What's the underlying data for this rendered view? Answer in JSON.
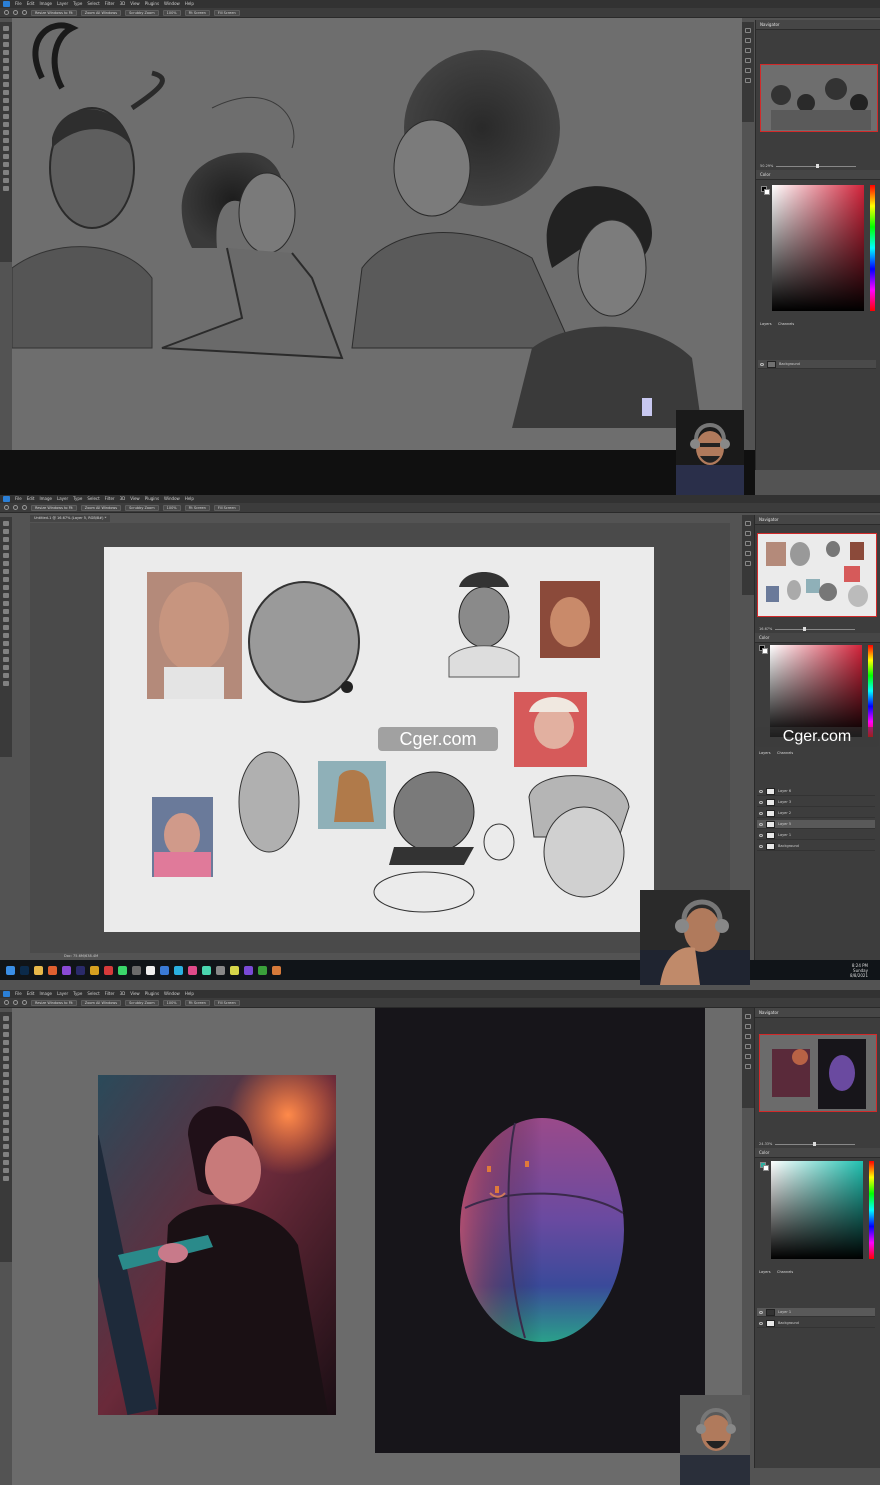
{
  "app": {
    "menu_items": [
      "File",
      "Edit",
      "Image",
      "Layer",
      "Type",
      "Select",
      "Filter",
      "3D",
      "View",
      "Plugins",
      "Window",
      "Help"
    ],
    "options_buttons": [
      "Resize Windows to Fit",
      "Zoom All Windows",
      "Scrubby Zoom",
      "100%",
      "Fit Screen",
      "Fill Screen"
    ]
  },
  "shot1": {
    "panel_title": "Navigator",
    "zoom": "50.29%",
    "color_title": "Color",
    "layers_tabs": [
      "Layers",
      "Channels"
    ],
    "layers": [
      {
        "name": "Background"
      }
    ]
  },
  "shot2": {
    "doc_tab": "Untitled-1 @ 16.67% (Layer 5, RGB/8#) *",
    "panel_title": "Navigator",
    "zoom": "16.67%",
    "color_title": "Color",
    "layers_tabs": [
      "Layers",
      "Channels"
    ],
    "layers": [
      {
        "name": "Layer 6"
      },
      {
        "name": "Layer 3"
      },
      {
        "name": "Layer 2"
      },
      {
        "name": "Layer 5"
      },
      {
        "name": "Layer 1"
      },
      {
        "name": "Background"
      }
    ],
    "status": "Doc: 75.6M/638.4M",
    "watermark": "Cger.com",
    "watermark_side": "Cger.com",
    "tray": {
      "time": "8:24 PM",
      "day": "Sunday",
      "date": "8/8/2021"
    }
  },
  "shot3": {
    "panel_title": "Navigator",
    "zoom": "24.33%",
    "color_title": "Color",
    "layers_tabs": [
      "Layers",
      "Channels"
    ],
    "layers": [
      {
        "name": "Layer 1"
      },
      {
        "name": "Background"
      }
    ]
  },
  "colors": {
    "ui_dark": "#323232",
    "panel": "#3d3d3d",
    "canvas_gray": "#6a6a6a",
    "nav_border": "#d22a2a",
    "ps_blue": "#2b7fd6"
  }
}
